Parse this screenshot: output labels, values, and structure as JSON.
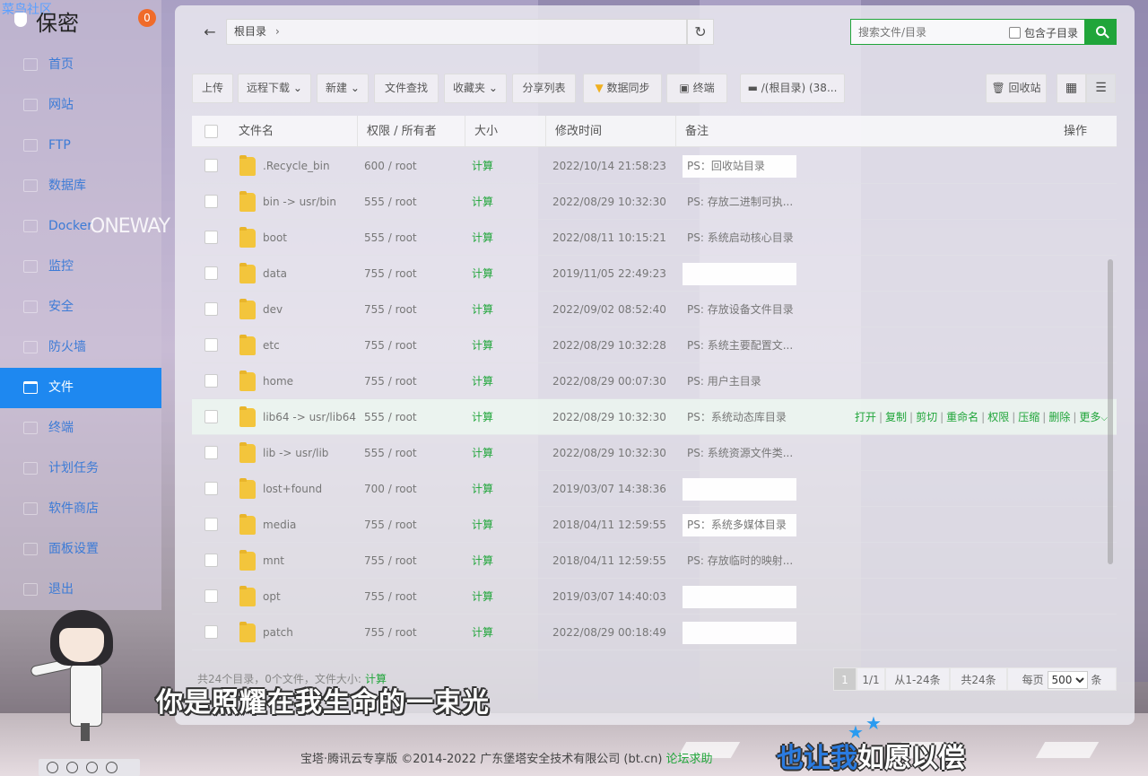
{
  "sidebar": {
    "watermark": "菜鸟社区",
    "title": "保密",
    "badge": "0",
    "items": [
      {
        "label": "首页",
        "icon": "home-icon"
      },
      {
        "label": "网站",
        "icon": "globe-icon"
      },
      {
        "label": "FTP",
        "icon": "ftp-icon"
      },
      {
        "label": "数据库",
        "icon": "database-icon"
      },
      {
        "label": "Docker",
        "icon": "docker-icon"
      },
      {
        "label": "监控",
        "icon": "monitor-icon"
      },
      {
        "label": "安全",
        "icon": "shield-icon"
      },
      {
        "label": "防火墙",
        "icon": "firewall-icon"
      },
      {
        "label": "文件",
        "icon": "folder-icon",
        "active": true
      },
      {
        "label": "终端",
        "icon": "terminal-icon"
      },
      {
        "label": "计划任务",
        "icon": "clock-icon"
      },
      {
        "label": "软件商店",
        "icon": "store-icon"
      },
      {
        "label": "面板设置",
        "icon": "gear-icon"
      },
      {
        "label": "退出",
        "icon": "logout-icon"
      }
    ]
  },
  "pathbar": {
    "path": "根目录",
    "search_placeholder": "搜索文件/目录",
    "include_sub": "包含子目录"
  },
  "toolbar": {
    "upload": "上传",
    "remote_download": "远程下载",
    "new": "新建",
    "find": "文件查找",
    "favorites": "收藏夹",
    "share_list": "分享列表",
    "data_sync": "数据同步",
    "terminal": "终端",
    "disk": "/(根目录) (38...",
    "recycle": "回收站"
  },
  "table": {
    "headers": {
      "name": "文件名",
      "perm": "权限 / 所有者",
      "size": "大小",
      "mtime": "修改时间",
      "remark": "备注",
      "ops": "操作"
    },
    "rows": [
      {
        "name": ".Recycle_bin",
        "perm": "600 / root",
        "size": "计算",
        "mtime": "2022/10/14 21:58:23",
        "remark": "PS：回收站目录",
        "boxed": true
      },
      {
        "name": "bin -> usr/bin",
        "perm": "555 / root",
        "size": "计算",
        "mtime": "2022/08/29 10:32:30",
        "remark": "PS: 存放二进制可执...",
        "boxed": false
      },
      {
        "name": "boot",
        "perm": "555 / root",
        "size": "计算",
        "mtime": "2022/08/11 10:15:21",
        "remark": "PS: 系统启动核心目录",
        "boxed": false
      },
      {
        "name": "data",
        "perm": "755 / root",
        "size": "计算",
        "mtime": "2019/11/05 22:49:23",
        "remark": "",
        "boxed": true
      },
      {
        "name": "dev",
        "perm": "755 / root",
        "size": "计算",
        "mtime": "2022/09/02 08:52:40",
        "remark": "PS: 存放设备文件目录",
        "boxed": false
      },
      {
        "name": "etc",
        "perm": "755 / root",
        "size": "计算",
        "mtime": "2022/08/29 10:32:28",
        "remark": "PS: 系统主要配置文...",
        "boxed": false
      },
      {
        "name": "home",
        "perm": "755 / root",
        "size": "计算",
        "mtime": "2022/08/29 00:07:30",
        "remark": "PS: 用户主目录",
        "boxed": false
      },
      {
        "name": "lib64 -> usr/lib64",
        "perm": "555 / root",
        "size": "计算",
        "mtime": "2022/08/29 10:32:30",
        "remark": "PS：系统动态库目录",
        "boxed": false,
        "hover": true
      },
      {
        "name": "lib -> usr/lib",
        "perm": "555 / root",
        "size": "计算",
        "mtime": "2022/08/29 10:32:30",
        "remark": "PS: 系统资源文件类...",
        "boxed": false
      },
      {
        "name": "lost+found",
        "perm": "700 / root",
        "size": "计算",
        "mtime": "2019/03/07 14:38:36",
        "remark": "",
        "boxed": true
      },
      {
        "name": "media",
        "perm": "755 / root",
        "size": "计算",
        "mtime": "2018/04/11 12:59:55",
        "remark": "PS：系统多媒体目录",
        "boxed": true
      },
      {
        "name": "mnt",
        "perm": "755 / root",
        "size": "计算",
        "mtime": "2018/04/11 12:59:55",
        "remark": "PS: 存放临时的映射...",
        "boxed": false
      },
      {
        "name": "opt",
        "perm": "755 / root",
        "size": "计算",
        "mtime": "2019/03/07 14:40:03",
        "remark": "",
        "boxed": true
      },
      {
        "name": "patch",
        "perm": "755 / root",
        "size": "计算",
        "mtime": "2022/08/29 00:18:49",
        "remark": "",
        "boxed": true
      }
    ],
    "row_ops": [
      "打开",
      "复制",
      "剪切",
      "重命名",
      "权限",
      "压缩",
      "删除",
      "更多"
    ]
  },
  "footer": {
    "summary": "共24个目录，0个文件，文件大小:",
    "calc": "计算",
    "page_current": "1",
    "page_total": "1/1",
    "range": "从1-24条",
    "total": "共24条",
    "per_page_label": "每页",
    "per_page": "500",
    "per_page_unit": "条"
  },
  "copyright": {
    "text": "宝塔·腾讯云专享版 ©2014-2022 广东堡塔安全技术有限公司 (bt.cn)",
    "link": "论坛求助"
  },
  "captions": {
    "line1": "你是照耀在我生命的一束光",
    "line2_highlight": "也让我",
    "line2_rest": "如愿以偿"
  },
  "background_sign": "ONEWAY",
  "colors": {
    "accent": "#20a53a",
    "active_menu": "#1e88f0",
    "badge": "#f06b2a"
  }
}
